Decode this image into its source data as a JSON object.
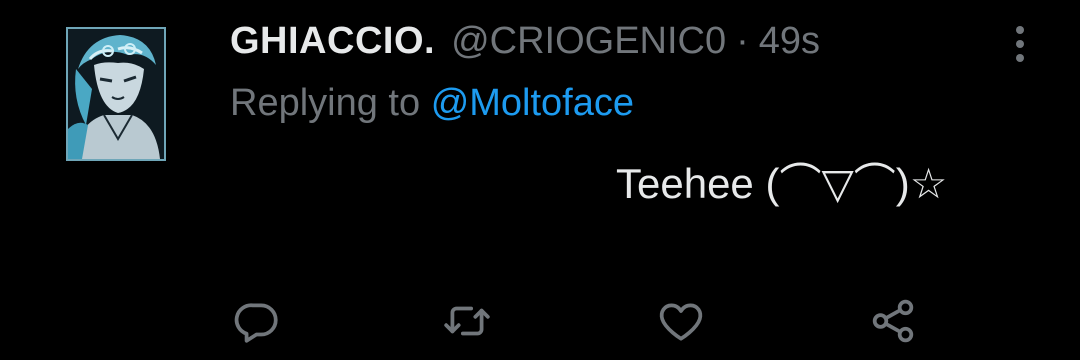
{
  "tweet": {
    "display_name": "GHIACCIO.",
    "handle": "@CRIOGENIC0",
    "separator": "·",
    "time": "49s",
    "replying_prefix": "Replying to",
    "replying_mention": "@Moltoface",
    "text": "Teehee (⌒▽⌒)☆"
  },
  "icons": {
    "more": "more-vertical-icon",
    "reply": "reply-icon",
    "retweet": "retweet-icon",
    "like": "heart-icon",
    "share": "share-icon"
  },
  "colors": {
    "background": "#000000",
    "primary_text": "#e7e9ea",
    "secondary_text": "#71767b",
    "accent": "#1d9bf0"
  }
}
